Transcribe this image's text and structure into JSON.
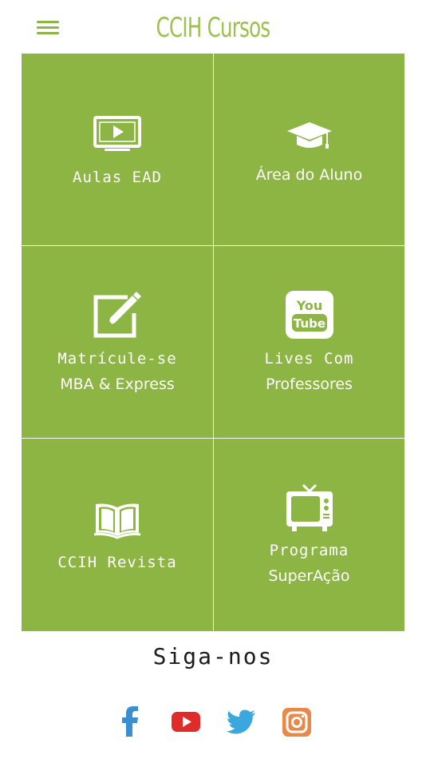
{
  "header": {
    "title": "CCIH Cursos",
    "menu_icon": "hamburger-menu-icon"
  },
  "colors": {
    "brand_green": "#8db544",
    "title_green": "#9cc24a",
    "facebook": "#3b8fd0",
    "youtube": "#e02b2b",
    "twitter": "#3aa7de",
    "instagram": "#e8894a"
  },
  "tiles": [
    {
      "icon": "tv-play-icon",
      "line1": "Aulas EAD",
      "line2": ""
    },
    {
      "icon": "graduation-cap-icon",
      "line1": "Área do Aluno",
      "line2": ""
    },
    {
      "icon": "edit-pencil-icon",
      "line1": "Matrícule-se",
      "line2": "MBA & Express"
    },
    {
      "icon": "youtube-icon",
      "line1": "Lives Com",
      "line2": "Professores"
    },
    {
      "icon": "open-book-icon",
      "line1": "CCIH Revista",
      "line2": ""
    },
    {
      "icon": "retro-tv-icon",
      "line1": "Programa",
      "line2": "SuperAção"
    }
  ],
  "youtube_icon_text": {
    "top": "You",
    "bottom": "Tube"
  },
  "footer": {
    "follow_label": "Siga-nos",
    "social": [
      {
        "name": "facebook",
        "icon": "facebook-icon"
      },
      {
        "name": "youtube",
        "icon": "youtube-icon"
      },
      {
        "name": "twitter",
        "icon": "twitter-icon"
      },
      {
        "name": "instagram",
        "icon": "instagram-icon"
      }
    ]
  }
}
